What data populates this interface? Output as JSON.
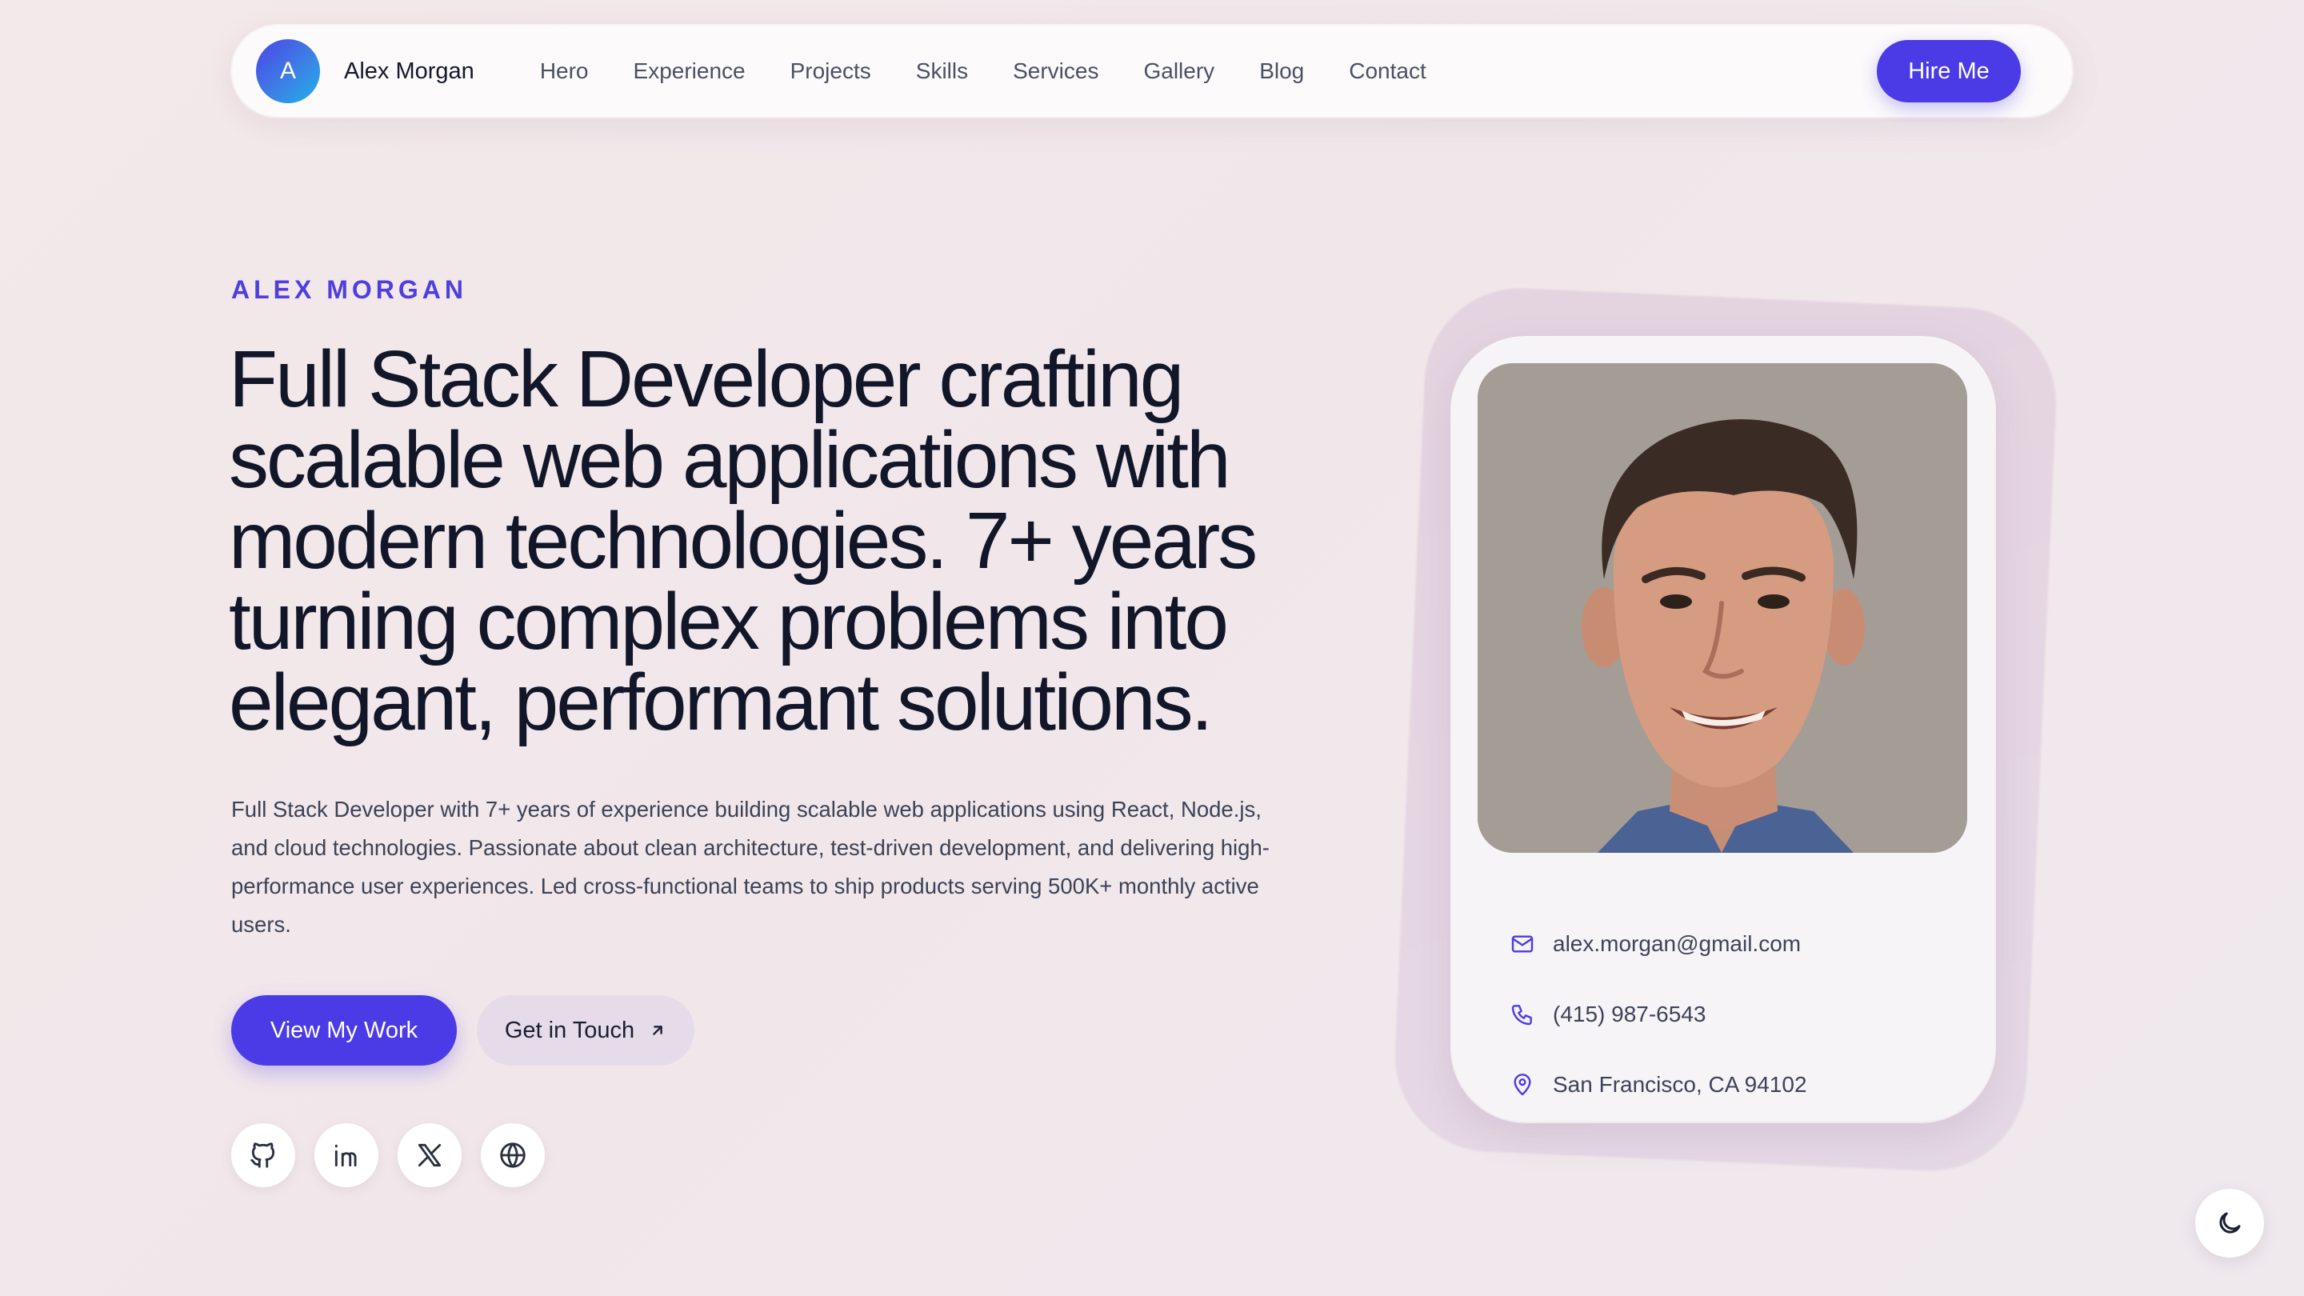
{
  "nav": {
    "avatar_letter": "A",
    "brand_name": "Alex Morgan",
    "links": [
      "Hero",
      "Experience",
      "Projects",
      "Skills",
      "Services",
      "Gallery",
      "Blog",
      "Contact"
    ],
    "cta_label": "Hire Me"
  },
  "hero": {
    "eyebrow": "ALEX MORGAN",
    "headline": "Full Stack Developer crafting scalable web applications with modern technologies. 7+ years turning complex problems into elegant, performant solutions.",
    "bio": "Full Stack Developer with 7+ years of experience building scalable web applications using React, Node.js, and cloud technologies. Passionate about clean architecture, test-driven development, and delivering high-performance user experiences. Led cross-functional teams to ship products serving 500K+ monthly active users.",
    "primary_cta": "View My Work",
    "secondary_cta": "Get in Touch",
    "socials": [
      "github-icon",
      "linkedin-icon",
      "x-icon",
      "globe-icon"
    ]
  },
  "profile": {
    "email": "alex.morgan@gmail.com",
    "phone": "(415) 987-6543",
    "location": "San Francisco, CA 94102"
  },
  "colors": {
    "accent": "#4a3be6",
    "background": "#f3e8ea",
    "heading": "#111629"
  },
  "theme_toggle_icon": "moon-icon"
}
